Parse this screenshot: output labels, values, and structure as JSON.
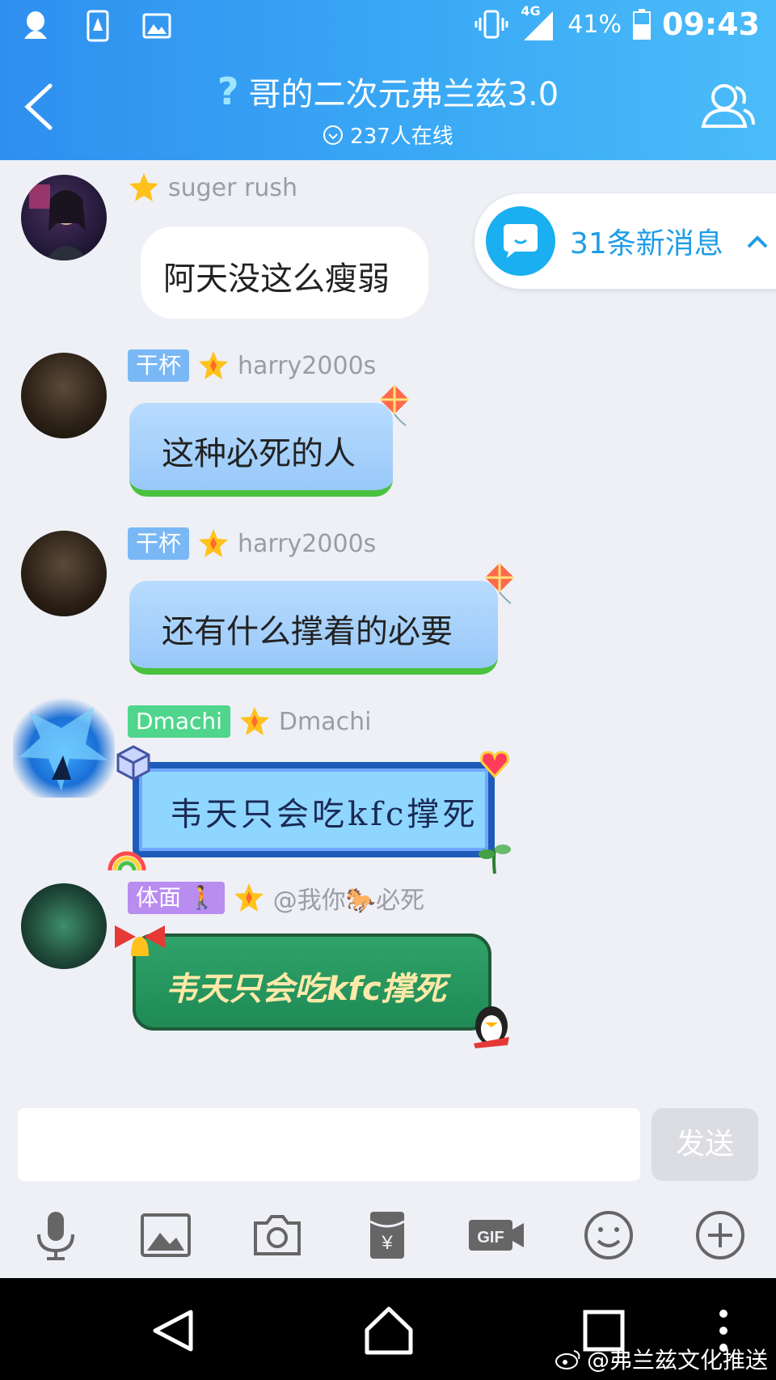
{
  "status_bar": {
    "network": "4G",
    "battery_percent": "41%",
    "time": "09:43"
  },
  "header": {
    "title": "哥的二次元弗兰兹3.0",
    "online_count": "237人在线"
  },
  "new_messages": {
    "label": "31条新消息"
  },
  "messages": [
    {
      "tag": "",
      "username": "suger  rush",
      "text": "阿天没这么瘦弱"
    },
    {
      "tag": "干杯",
      "username": "harry2000s",
      "text": "这种必死的人"
    },
    {
      "tag": "干杯",
      "username": "harry2000s",
      "text": "还有什么撑着的必要"
    },
    {
      "tag": "Dmachi",
      "username": "Dmachi",
      "text": "韦天只会吃kfc撑死"
    },
    {
      "tag": "体面",
      "username": "@我你🐎必死",
      "text": "韦天只会吃kfc撑死"
    }
  ],
  "composer": {
    "send_label": "发送"
  },
  "watermark": "@弗兰兹文化推送",
  "colors": {
    "header": "#3aa9f5",
    "accent": "#1e9de6",
    "tag_blue": "#7ab8f5",
    "tag_green": "#4fd68c",
    "tag_purple": "#b98cf0"
  }
}
